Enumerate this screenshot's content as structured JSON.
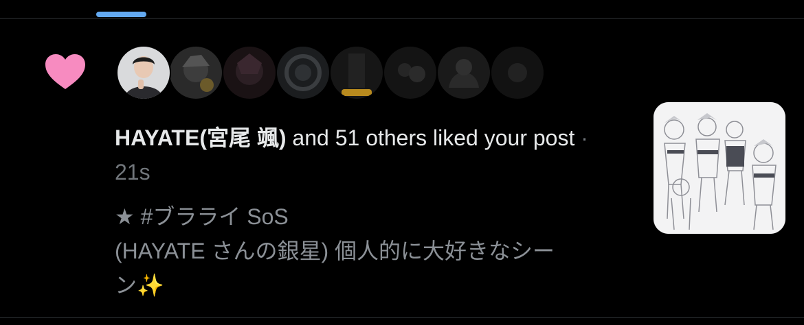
{
  "notification": {
    "type_icon": "heart-icon",
    "accent_color": "#f78bc0",
    "actor_name": "HAYATE(宮尾 颯)",
    "action_text": " and 51 others liked your post",
    "separator": " · ",
    "timestamp": "21s"
  },
  "avatars": [
    {
      "icon": "avatar-photo"
    },
    {
      "icon": "avatar-2"
    },
    {
      "icon": "avatar-3"
    },
    {
      "icon": "avatar-4"
    },
    {
      "icon": "avatar-5"
    },
    {
      "icon": "avatar-6"
    },
    {
      "icon": "avatar-7"
    },
    {
      "icon": "avatar-8"
    }
  ],
  "post": {
    "line1": "★ #ブラライ SoS",
    "line2": "(HAYATE さんの銀星) 個人的に大好きなシー",
    "line3": "ン✨"
  },
  "thumbnail": {
    "icon": "post-thumbnail-image"
  },
  "colors": {
    "background": "#000000",
    "primary_text": "#e7e9ea",
    "secondary_text": "#71767b",
    "tab_indicator": "#63a9f0",
    "divider": "#2f3336"
  }
}
